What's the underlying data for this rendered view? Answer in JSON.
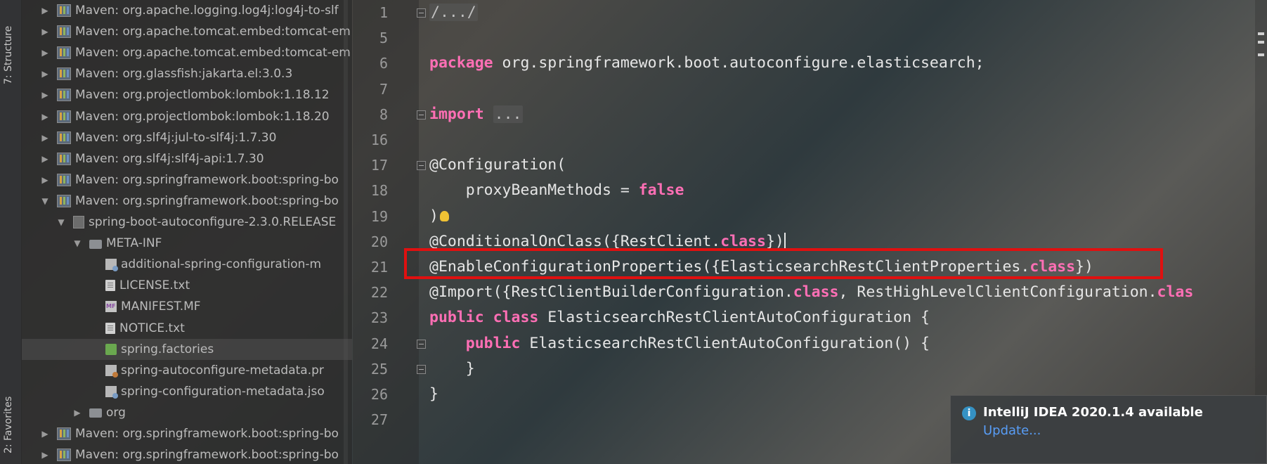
{
  "sidebar": {
    "structure_tab": "7: Structure",
    "favorites_tab": "2: Favorites"
  },
  "tree": {
    "items": [
      {
        "label": "Maven: org.apache.logging.log4j:log4j-to-slf",
        "expanded": false,
        "icon": "library-icon",
        "indent": 0
      },
      {
        "label": "Maven: org.apache.tomcat.embed:tomcat-em",
        "expanded": false,
        "icon": "library-icon",
        "indent": 0
      },
      {
        "label": "Maven: org.apache.tomcat.embed:tomcat-em",
        "expanded": false,
        "icon": "library-icon",
        "indent": 0
      },
      {
        "label": "Maven: org.glassfish:jakarta.el:3.0.3",
        "expanded": false,
        "icon": "library-icon",
        "indent": 0
      },
      {
        "label": "Maven: org.projectlombok:lombok:1.18.12",
        "expanded": false,
        "icon": "library-icon",
        "indent": 0
      },
      {
        "label": "Maven: org.projectlombok:lombok:1.18.20",
        "expanded": false,
        "icon": "library-icon",
        "indent": 0
      },
      {
        "label": "Maven: org.slf4j:jul-to-slf4j:1.7.30",
        "expanded": false,
        "icon": "library-icon",
        "indent": 0
      },
      {
        "label": "Maven: org.slf4j:slf4j-api:1.7.30",
        "expanded": false,
        "icon": "library-icon",
        "indent": 0
      },
      {
        "label": "Maven: org.springframework.boot:spring-bo",
        "expanded": false,
        "icon": "library-icon",
        "indent": 0
      },
      {
        "label": "Maven: org.springframework.boot:spring-bo",
        "expanded": true,
        "icon": "library-icon",
        "indent": 0
      },
      {
        "label": "spring-boot-autoconfigure-2.3.0.RELEASE",
        "expanded": true,
        "icon": "jar-icon",
        "indent": 1
      },
      {
        "label": "META-INF",
        "expanded": true,
        "icon": "folder-icon",
        "indent": 2
      },
      {
        "label": "additional-spring-configuration-m",
        "expanded": null,
        "icon": "json-file-icon",
        "indent": 3
      },
      {
        "label": "LICENSE.txt",
        "expanded": null,
        "icon": "text-file-icon",
        "indent": 3
      },
      {
        "label": "MANIFEST.MF",
        "expanded": null,
        "icon": "manifest-icon",
        "indent": 3
      },
      {
        "label": "NOTICE.txt",
        "expanded": null,
        "icon": "text-file-icon",
        "indent": 3
      },
      {
        "label": "spring.factories",
        "expanded": null,
        "icon": "spring-factories-icon",
        "indent": 3,
        "selected": true
      },
      {
        "label": "spring-autoconfigure-metadata.pr",
        "expanded": null,
        "icon": "properties-file-icon",
        "indent": 3
      },
      {
        "label": "spring-configuration-metadata.jso",
        "expanded": null,
        "icon": "json-file-icon",
        "indent": 3
      },
      {
        "label": "org",
        "expanded": false,
        "icon": "folder-icon",
        "indent": 2
      },
      {
        "label": "Maven: org.springframework.boot:spring-bo",
        "expanded": false,
        "icon": "library-icon",
        "indent": 0
      },
      {
        "label": "Maven: org.springframework.boot:spring-bo",
        "expanded": false,
        "icon": "library-icon",
        "indent": 0
      }
    ]
  },
  "editor": {
    "lines": [
      {
        "num": "1",
        "tokens": [
          {
            "t": "/.../",
            "c": "collapsed"
          }
        ]
      },
      {
        "num": "5",
        "tokens": []
      },
      {
        "num": "6",
        "tokens": [
          {
            "t": "package",
            "c": "kw"
          },
          {
            "t": " org.springframework.boot.autoconfigure.elasticsearch;",
            "c": ""
          }
        ]
      },
      {
        "num": "7",
        "tokens": []
      },
      {
        "num": "8",
        "tokens": [
          {
            "t": "import",
            "c": "kw"
          },
          {
            "t": " ",
            "c": ""
          },
          {
            "t": "...",
            "c": "collapsed"
          }
        ]
      },
      {
        "num": "16",
        "tokens": []
      },
      {
        "num": "17",
        "tokens": [
          {
            "t": "@Configuration(",
            "c": "ann"
          }
        ]
      },
      {
        "num": "18",
        "tokens": [
          {
            "t": "    proxyBeanMethods = ",
            "c": ""
          },
          {
            "t": "false",
            "c": "kw"
          }
        ]
      },
      {
        "num": "19",
        "tokens": [
          {
            "t": ")",
            "c": ""
          }
        ]
      },
      {
        "num": "20",
        "tokens": [
          {
            "t": "@ConditionalOnClass({RestClient.",
            "c": "ann"
          },
          {
            "t": "class",
            "c": "kw"
          },
          {
            "t": "})",
            "c": ""
          }
        ]
      },
      {
        "num": "21",
        "tokens": [
          {
            "t": "@EnableConfigurationProperties({ElasticsearchRestClientProperties.",
            "c": "ann"
          },
          {
            "t": "class",
            "c": "kw"
          },
          {
            "t": "})",
            "c": ""
          }
        ]
      },
      {
        "num": "22",
        "tokens": [
          {
            "t": "@Import({RestClientBuilderConfiguration.",
            "c": "ann"
          },
          {
            "t": "class",
            "c": "kw"
          },
          {
            "t": ", RestHighLevelClientConfiguration.",
            "c": ""
          },
          {
            "t": "clas",
            "c": "kw"
          }
        ]
      },
      {
        "num": "23",
        "tokens": [
          {
            "t": "public",
            "c": "kw"
          },
          {
            "t": " ",
            "c": ""
          },
          {
            "t": "class",
            "c": "kw"
          },
          {
            "t": " ElasticsearchRestClientAutoConfiguration {",
            "c": ""
          }
        ]
      },
      {
        "num": "24",
        "tokens": [
          {
            "t": "    ",
            "c": ""
          },
          {
            "t": "public",
            "c": "kw"
          },
          {
            "t": " ElasticsearchRestClientAutoConfiguration() {",
            "c": ""
          }
        ]
      },
      {
        "num": "25",
        "tokens": [
          {
            "t": "    }",
            "c": ""
          }
        ]
      },
      {
        "num": "26",
        "tokens": [
          {
            "t": "}",
            "c": ""
          }
        ]
      },
      {
        "num": "27",
        "tokens": []
      }
    ]
  },
  "notification": {
    "title": "IntelliJ IDEA 2020.1.4 available",
    "link": "Update...",
    "icon": "info-icon"
  },
  "colors": {
    "keyword": "#ff6fb5",
    "highlight_border": "#e01010",
    "link": "#589df6"
  }
}
